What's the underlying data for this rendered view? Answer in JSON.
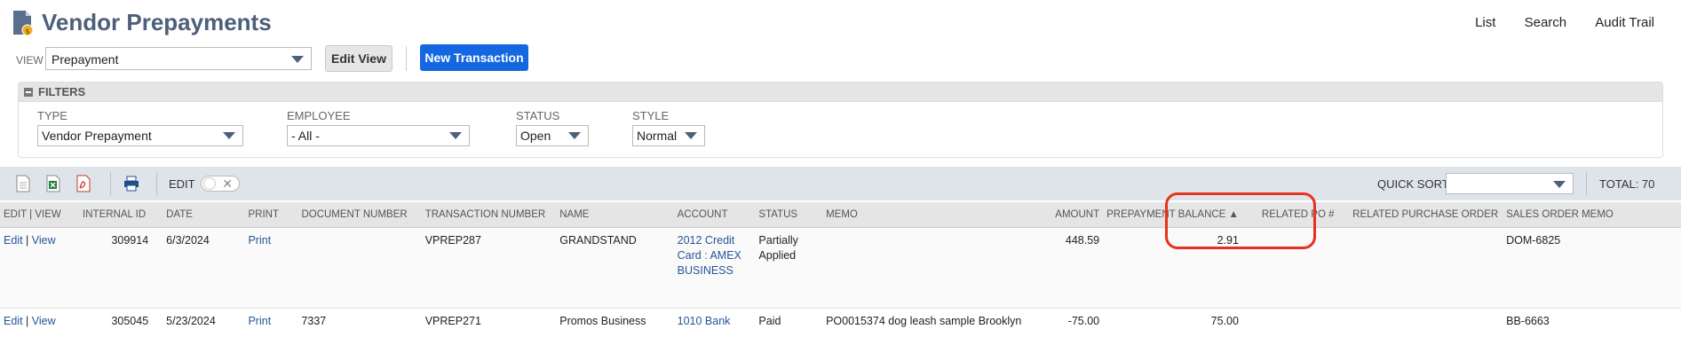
{
  "header": {
    "title": "Vendor Prepayments",
    "links": [
      "List",
      "Search",
      "Audit Trail"
    ]
  },
  "view": {
    "label": "VIEW",
    "selected": "Prepayment",
    "edit_view": "Edit View",
    "new_transaction": "New Transaction"
  },
  "filters": {
    "title": "FILTERS",
    "type": {
      "label": "TYPE",
      "value": "Vendor Prepayment"
    },
    "employee": {
      "label": "EMPLOYEE",
      "value": "- All -"
    },
    "status": {
      "label": "STATUS",
      "value": "Open"
    },
    "style": {
      "label": "STYLE",
      "value": "Normal"
    }
  },
  "toolbar": {
    "icons": [
      "export-csv-icon",
      "export-excel-icon",
      "export-pdf-icon",
      "print-icon"
    ],
    "edit_label": "EDIT",
    "quick_sort_label": "QUICK SORT",
    "quick_sort_value": "",
    "total": "TOTAL: 70"
  },
  "table": {
    "columns": [
      "EDIT | VIEW",
      "INTERNAL ID",
      "DATE",
      "PRINT",
      "DOCUMENT NUMBER",
      "TRANSACTION NUMBER",
      "NAME",
      "ACCOUNT",
      "STATUS",
      "MEMO",
      "AMOUNT",
      "PREPAYMENT BALANCE ▲",
      "RELATED PO #",
      "RELATED PURCHASE ORDER",
      "SALES ORDER MEMO"
    ],
    "rows": [
      {
        "edit": "Edit",
        "view": "View",
        "internal_id": "309914",
        "date": "6/3/2024",
        "print": "Print",
        "doc_number": "",
        "txn_number": "VPREP287",
        "name": "GRANDSTAND",
        "account": "2012 Credit Card : AMEX BUSINESS",
        "status": "Partially Applied",
        "memo": "",
        "amount": "448.59",
        "balance": "2.91",
        "related_po": "",
        "related_purchase_order": "",
        "sales_order_memo": "DOM-6825"
      },
      {
        "edit": "Edit",
        "view": "View",
        "internal_id": "305045",
        "date": "5/23/2024",
        "print": "Print",
        "doc_number": "7337",
        "txn_number": "VPREP271",
        "name": "Promos Business",
        "account": "1010 Bank",
        "status": "Paid",
        "memo": "PO0015374 dog leash sample Brooklyn",
        "amount": "-75.00",
        "balance": "75.00",
        "related_po": "",
        "related_purchase_order": "",
        "sales_order_memo": "BB-6663"
      }
    ]
  }
}
